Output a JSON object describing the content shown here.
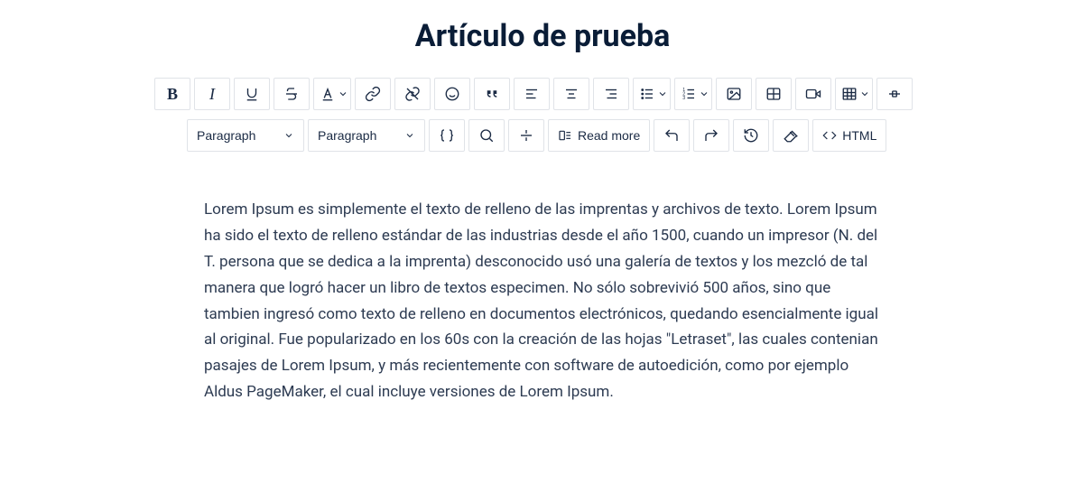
{
  "title": "Artículo de prueba",
  "toolbar": {
    "format_select_1": "Paragraph",
    "format_select_2": "Paragraph",
    "readmore_label": "Read more",
    "html_label": "HTML"
  },
  "content": {
    "body": "Lorem Ipsum es simplemente el texto de relleno de las imprentas y archivos de texto. Lorem Ipsum ha sido el texto de relleno estándar de las industrias desde el año 1500, cuando un impresor (N. del T. persona que se dedica a la imprenta) desconocido usó una galería de textos y los mezcló de tal manera que logró hacer un libro de textos especimen. No sólo sobrevivió 500 años, sino que tambien ingresó como texto de relleno en documentos electrónicos, quedando esencialmente igual al original. Fue popularizado en los 60s con la creación de las hojas \"Letraset\", las cuales contenian pasajes de Lorem Ipsum, y más recientemente con software de autoedición, como por ejemplo Aldus PageMaker, el cual incluye versiones de Lorem Ipsum."
  }
}
